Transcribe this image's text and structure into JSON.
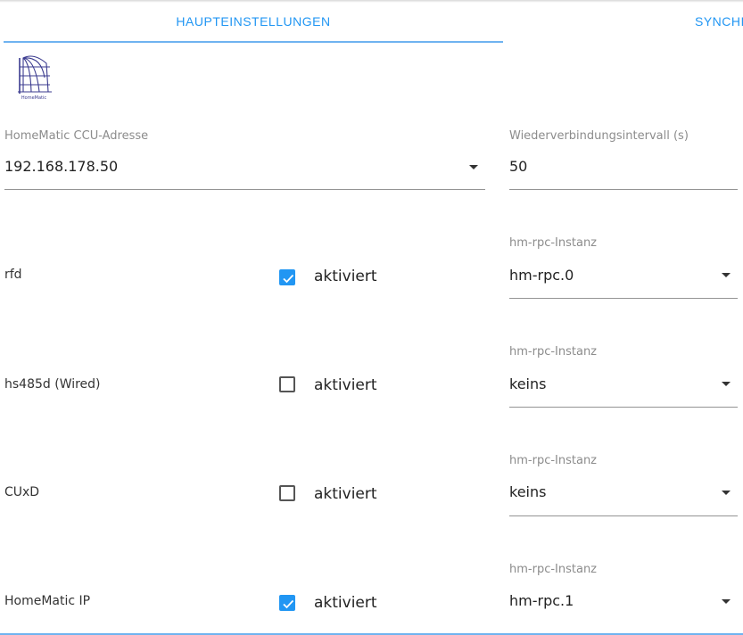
{
  "tabs": [
    {
      "label": "HAUPTEINSTELLUNGEN",
      "active": true
    },
    {
      "label": "SYNCHI",
      "active": false
    }
  ],
  "logo": {
    "text": "HomeMatic"
  },
  "ccu": {
    "label": "HomeMatic CCU-Adresse",
    "value": "192.168.178.50"
  },
  "reconnect": {
    "label": "Wiederverbindungsintervall (s)",
    "value": "50"
  },
  "rows": [
    {
      "name": "rfd",
      "checked": true,
      "check_label": "aktiviert",
      "instance_label": "hm-rpc-Instanz",
      "instance_value": "hm-rpc.0"
    },
    {
      "name": "hs485d (Wired)",
      "checked": false,
      "check_label": "aktiviert",
      "instance_label": "hm-rpc-Instanz",
      "instance_value": "keins"
    },
    {
      "name": "CUxD",
      "checked": false,
      "check_label": "aktiviert",
      "instance_label": "hm-rpc-Instanz",
      "instance_value": "keins"
    },
    {
      "name": "HomeMatic IP",
      "checked": true,
      "check_label": "aktiviert",
      "instance_label": "hm-rpc-Instanz",
      "instance_value": "hm-rpc.1"
    }
  ],
  "colors": {
    "accent": "#2196f3",
    "tab_underline": "#6fb3f0",
    "label_gray": "#8c8c8c"
  }
}
